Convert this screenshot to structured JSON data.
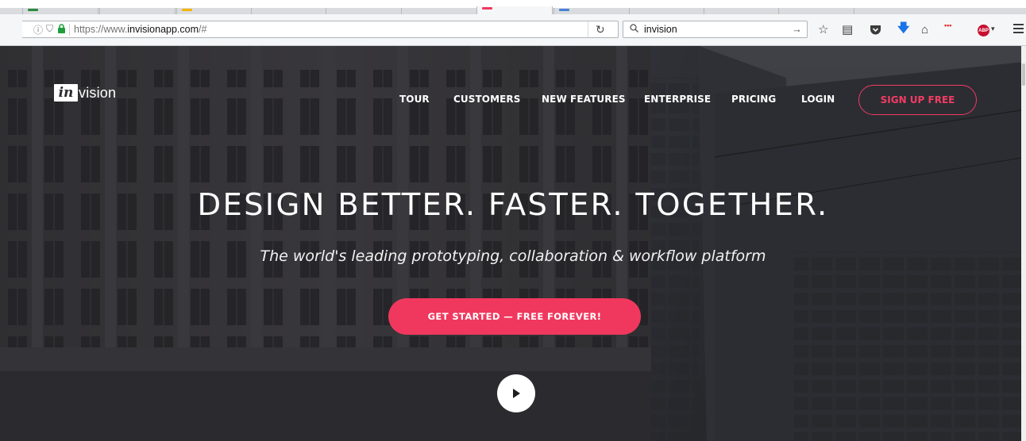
{
  "browser": {
    "url_prefix": "https://www.",
    "url_domain": "invisionapp.com",
    "url_suffix": "/#",
    "search_value": "invision",
    "extension_badge": "•••",
    "abp_label": "ABP"
  },
  "site": {
    "logo_in": "in",
    "logo_vision": "vision",
    "nav": [
      "TOUR",
      "CUSTOMERS",
      "NEW FEATURES",
      "ENTERPRISE",
      "PRICING",
      "LOGIN"
    ],
    "signup_label": "SIGN UP FREE",
    "headline": "DESIGN BETTER. FASTER. TOGETHER.",
    "subheadline": "The world's leading prototyping, collaboration & workflow platform",
    "cta_label": "GET STARTED — FREE FOREVER!"
  },
  "colors": {
    "accent": "#f0385e",
    "hero_overlay": "#2e2e33"
  },
  "icons": [
    "back-arrow-icon",
    "info-icon",
    "shield-icon",
    "lock-icon",
    "reload-icon",
    "search-icon",
    "bookmark-star-icon",
    "reading-list-icon",
    "pocket-icon",
    "download-icon",
    "home-icon",
    "menu-icon",
    "play-icon"
  ]
}
